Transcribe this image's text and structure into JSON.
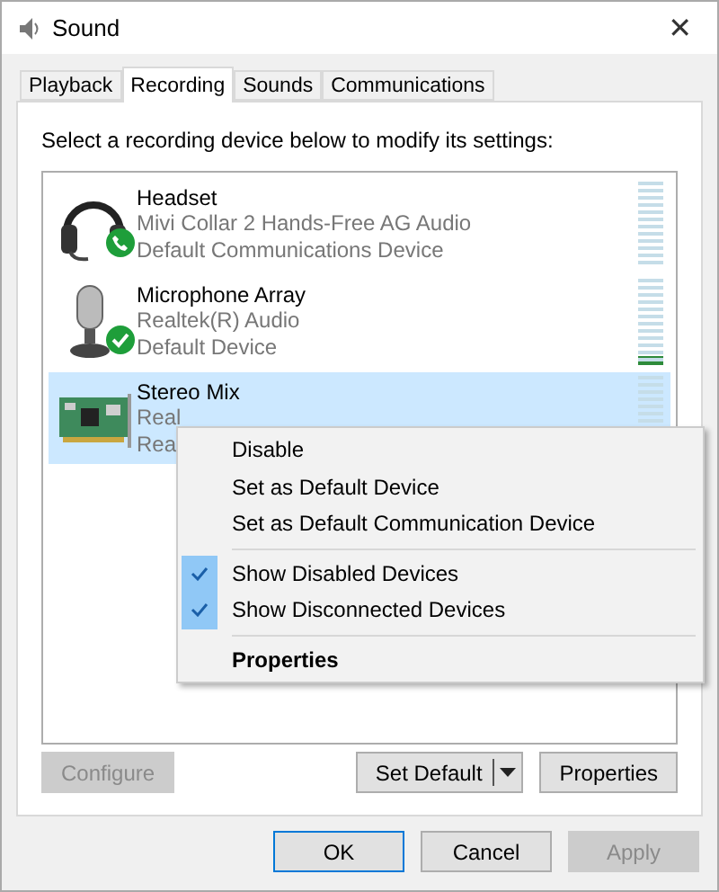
{
  "window": {
    "title": "Sound",
    "close": "✕"
  },
  "tabs": [
    {
      "label": "Playback",
      "selected": false
    },
    {
      "label": "Recording",
      "selected": true
    },
    {
      "label": "Sounds",
      "selected": false
    },
    {
      "label": "Communications",
      "selected": false
    }
  ],
  "instruction": "Select a recording device below to modify its settings:",
  "devices": [
    {
      "kind": "headset",
      "default_communications": true,
      "default_device": false,
      "name": "Headset",
      "lines": [
        "Mivi Collar 2 Hands-Free AG Audio",
        "Default Communications Device"
      ],
      "level": 0,
      "selected": false
    },
    {
      "kind": "microphone",
      "default_communications": false,
      "default_device": true,
      "name": "Microphone Array",
      "lines": [
        "Realtek(R) Audio",
        "Default Device"
      ],
      "level": 0.1,
      "selected": false
    },
    {
      "kind": "card",
      "default_communications": false,
      "default_device": false,
      "name": "Stereo Mix",
      "lines": [
        "Real",
        "Rea"
      ],
      "level": 0,
      "selected": true
    }
  ],
  "context_menu": [
    {
      "kind": "item",
      "label": "Disable",
      "checked": false
    },
    {
      "kind": "item",
      "label": "Set as Default Device",
      "checked": false
    },
    {
      "kind": "item",
      "label": "Set as Default Communication Device",
      "checked": false
    },
    {
      "kind": "separator"
    },
    {
      "kind": "item",
      "label": "Show Disabled Devices",
      "checked": true
    },
    {
      "kind": "item",
      "label": "Show Disconnected Devices",
      "checked": true
    },
    {
      "kind": "separator"
    },
    {
      "kind": "default",
      "label": "Properties",
      "checked": false
    }
  ],
  "panel_buttons": {
    "configure": {
      "label": "Configure",
      "disabled": true
    },
    "set_default": {
      "label": "Set Default",
      "disabled": false
    },
    "properties": {
      "label": "Properties",
      "disabled": false
    }
  },
  "dialog_buttons": [
    {
      "label": "OK",
      "disabled": false,
      "focused": true
    },
    {
      "label": "Cancel",
      "disabled": false,
      "focused": false
    },
    {
      "label": "Apply",
      "disabled": true,
      "focused": false
    }
  ]
}
